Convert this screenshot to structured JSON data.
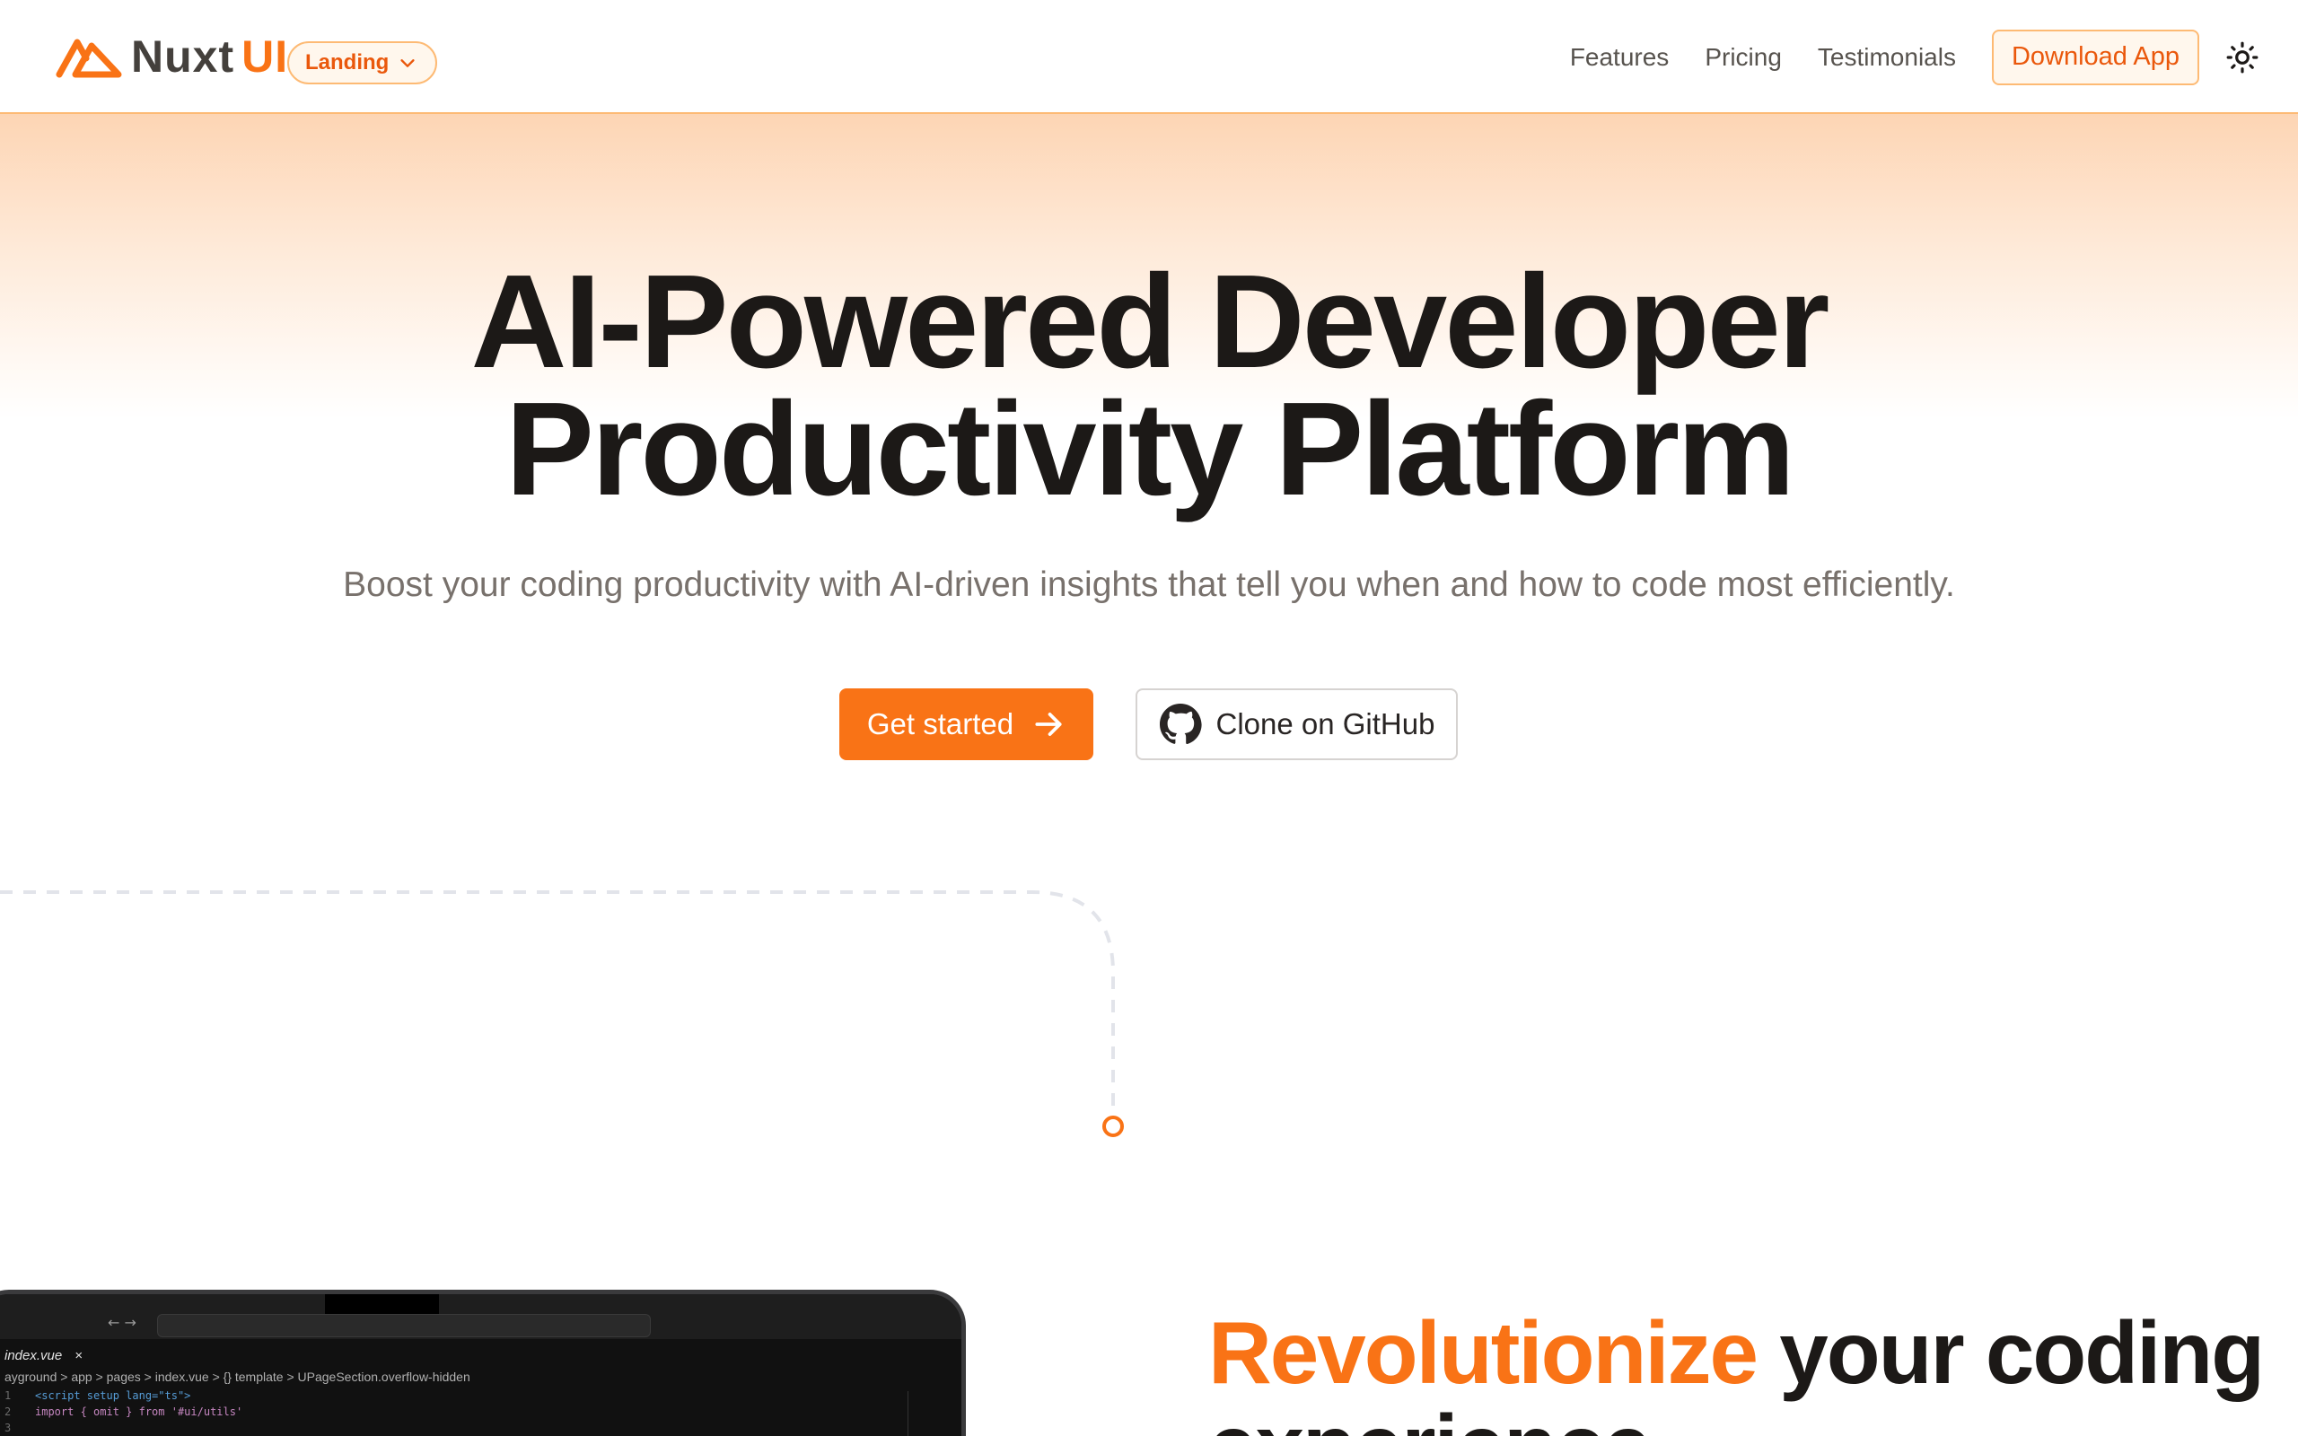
{
  "header": {
    "brand": {
      "name_part1": "Nuxt",
      "name_part2": "UI"
    },
    "variant_label": "Landing",
    "nav_links": [
      "Features",
      "Pricing",
      "Testimonials"
    ],
    "download_label": "Download App"
  },
  "hero": {
    "title_line1": "AI-Powered Developer",
    "title_line2": "Productivity Platform",
    "description": "Boost your coding productivity with AI-driven insights that tell you when and how to code most efficiently.",
    "primary_cta": "Get started",
    "secondary_cta": "Clone on GitHub"
  },
  "ide": {
    "tab": "index.vue",
    "breadcrumb": "ayground > app > pages > index.vue > {} template > UPageSection.overflow-hidden",
    "code_lines": [
      {
        "num": "1",
        "text": "<script setup lang=\"ts\">"
      },
      {
        "num": "2",
        "text": "import { omit } from '#ui/utils'"
      },
      {
        "num": "3",
        "text": ""
      }
    ]
  },
  "section": {
    "title_accent": "Revolutionize",
    "title_rest": " your coding",
    "title_line2": "experience"
  },
  "colors": {
    "primary": "#f97316",
    "primary_dark": "#ea580c",
    "primary_soft": "#fff7ed",
    "primary_border": "#fdba74",
    "text": "#1c1917",
    "muted": "#78716c"
  },
  "icons": [
    "nuxt-logo-icon",
    "chevron-down-icon",
    "sun-icon",
    "arrow-right-icon",
    "github-icon"
  ]
}
